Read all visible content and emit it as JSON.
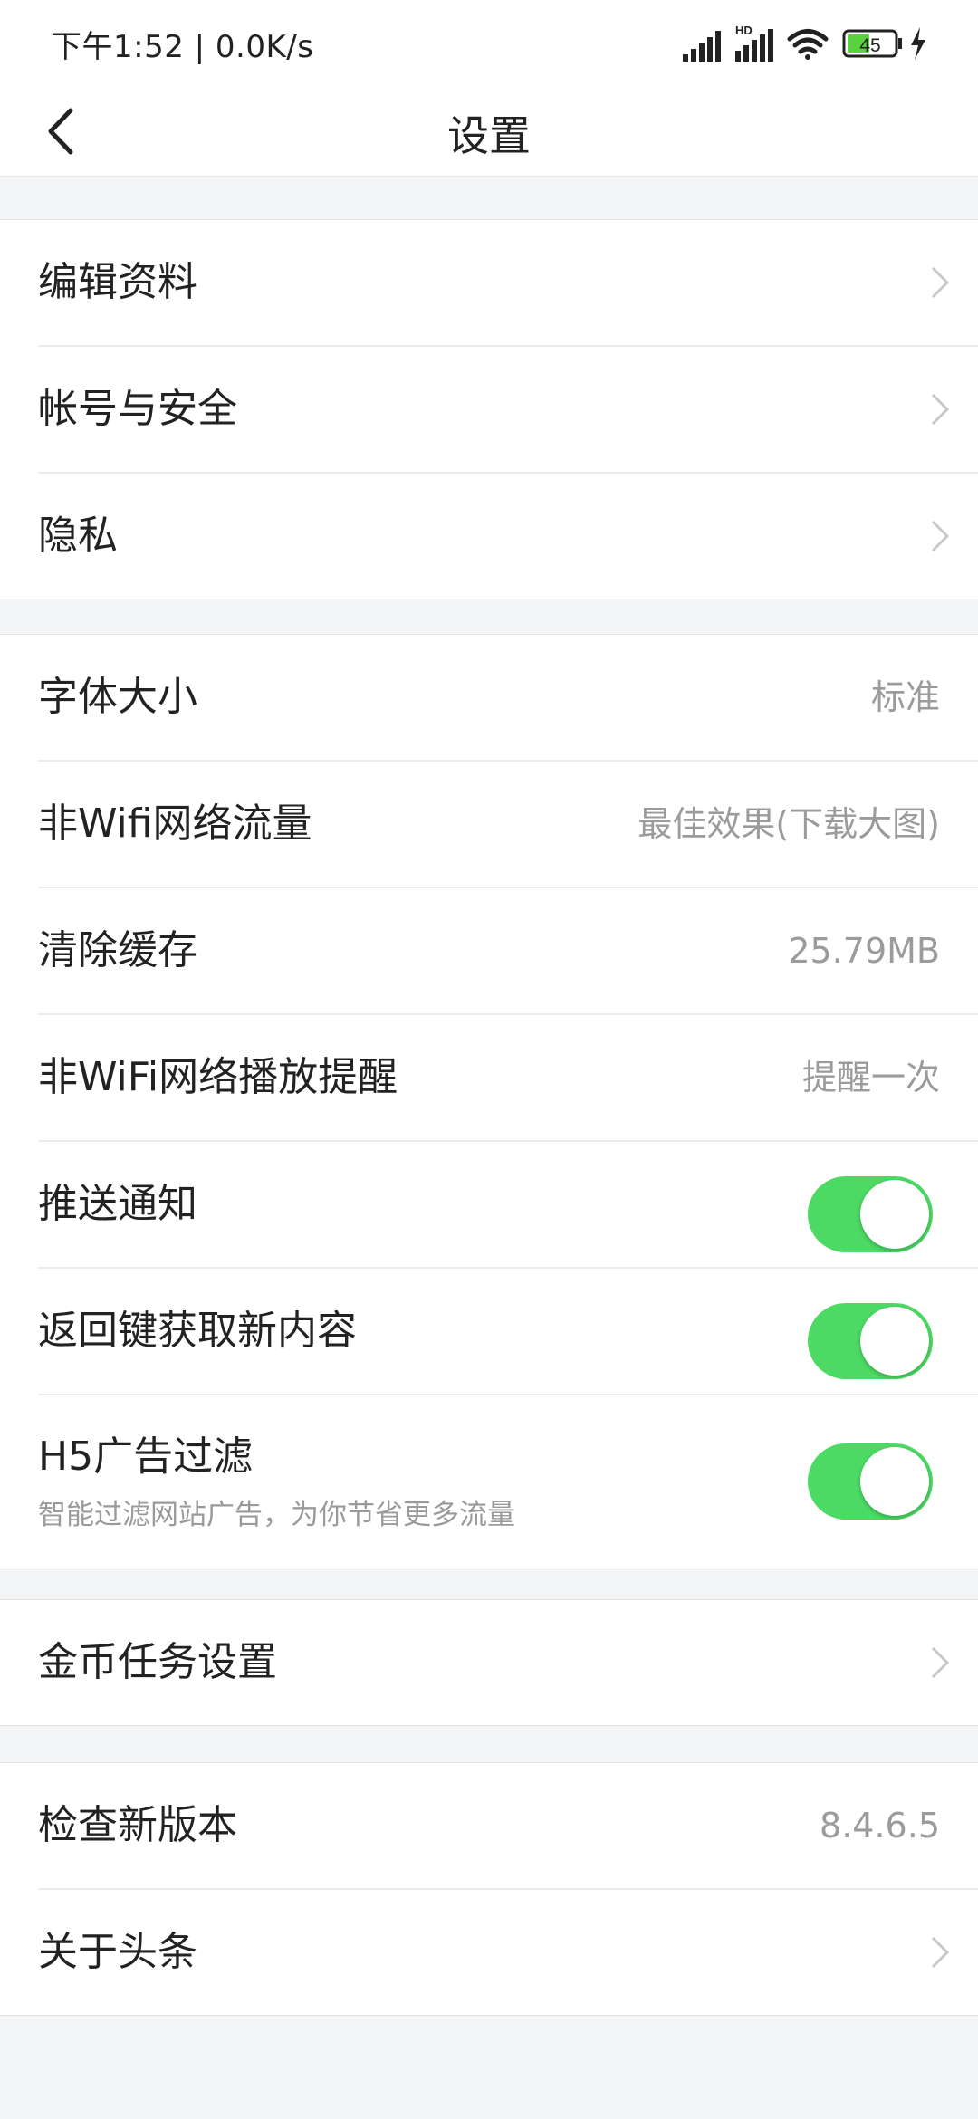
{
  "status_bar": {
    "time_speed": "下午1:52 | 0.0K/s",
    "hd_label": "HD",
    "battery": "45"
  },
  "header": {
    "title": "设置"
  },
  "section1": [
    {
      "label": "编辑资料"
    },
    {
      "label": "帐号与安全"
    },
    {
      "label": "隐私"
    }
  ],
  "section2": {
    "font_size": {
      "label": "字体大小",
      "value": "标准"
    },
    "non_wifi_traffic": {
      "label": "非Wifi网络流量",
      "value": "最佳效果(下载大图)"
    },
    "clear_cache": {
      "label": "清除缓存",
      "value": "25.79MB"
    },
    "non_wifi_play": {
      "label": "非WiFi网络播放提醒",
      "value": "提醒一次"
    },
    "push": {
      "label": "推送通知",
      "enabled": true
    },
    "back_refresh": {
      "label": "返回键获取新内容",
      "enabled": true
    },
    "h5_filter": {
      "label": "H5广告过滤",
      "subtitle": "智能过滤网站广告，为你节省更多流量",
      "enabled": true
    }
  },
  "section3": {
    "coin_task": {
      "label": "金币任务设置"
    }
  },
  "section4": {
    "check_version": {
      "label": "检查新版本",
      "value": "8.4.6.5"
    },
    "about": {
      "label": "关于头条"
    }
  },
  "colors": {
    "toggle_on": "#4cd964",
    "background": "#f4f5f6",
    "value_text": "#9b9b9b"
  }
}
